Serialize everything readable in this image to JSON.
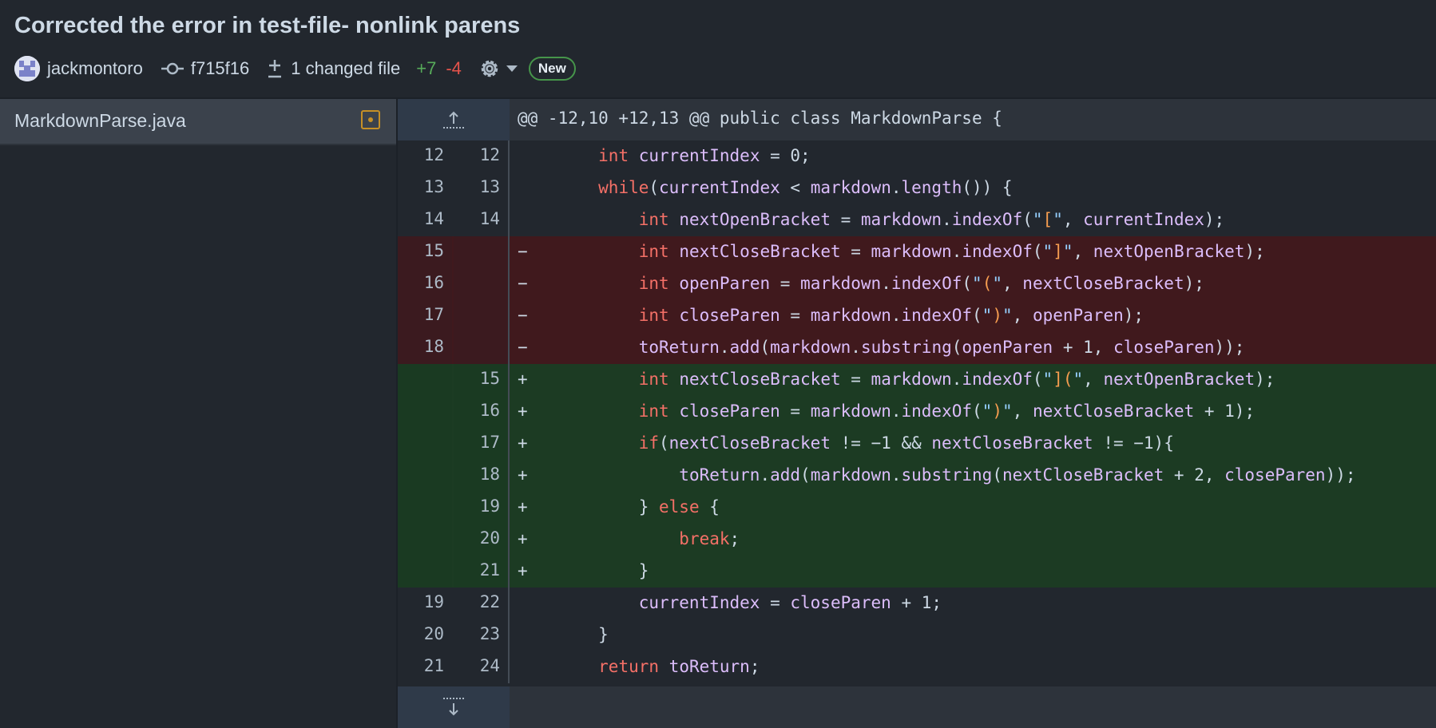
{
  "header": {
    "title": "Corrected the error in test-file- nonlink parens",
    "author": "jackmontoro",
    "commit": "f715f16",
    "changed_files": "1 changed file",
    "additions": "+7",
    "deletions": "-4",
    "badge": "New"
  },
  "sidebar": {
    "file": "MarkdownParse.java"
  },
  "diff": {
    "hunk": "@@ -12,10 +12,13 @@ public class MarkdownParse {"
  },
  "colors": {
    "background": "#22272e",
    "deleted_row": "#40191d",
    "added_row": "#1c3b23",
    "keyword": "#f47067",
    "identifier": "#dcbdfb",
    "string": "#96d0ff",
    "badge_border": "#46954a",
    "modified_icon": "#c69026"
  }
}
